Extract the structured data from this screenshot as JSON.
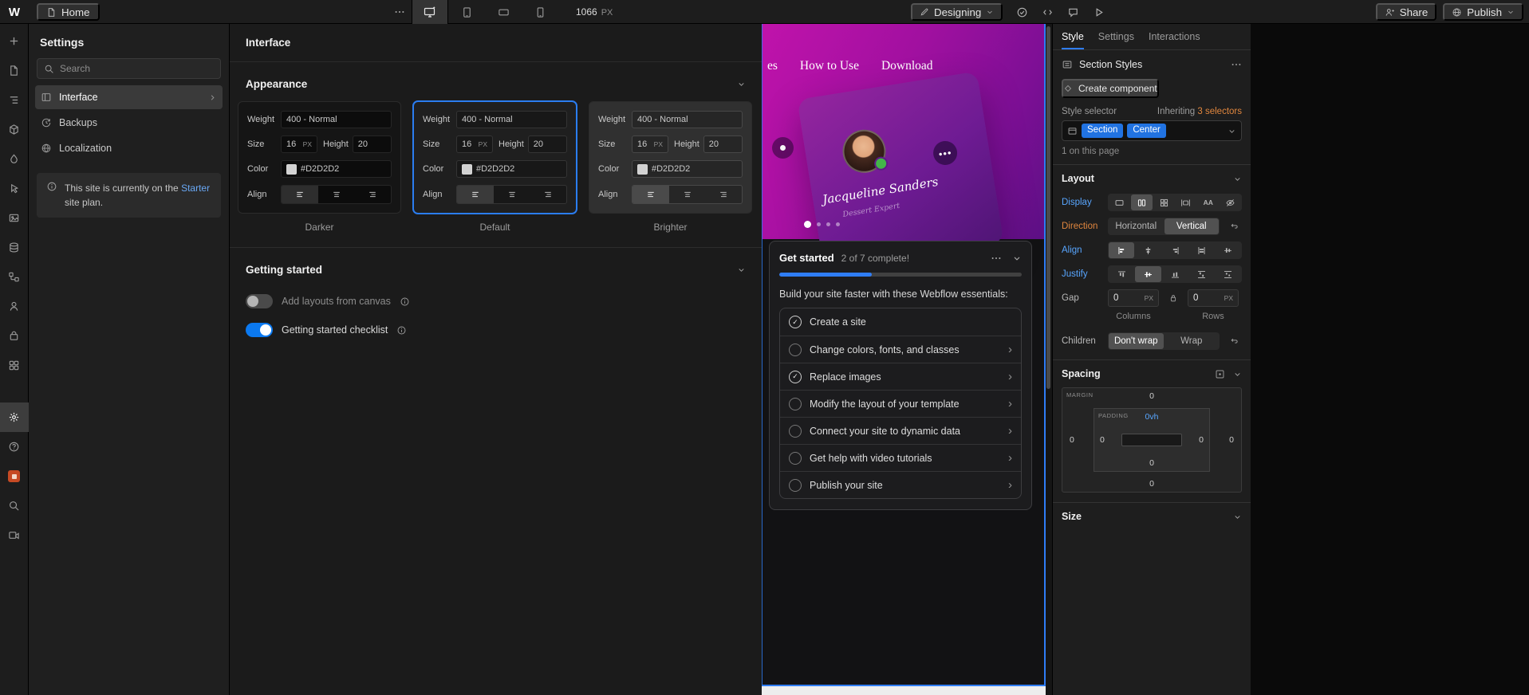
{
  "topbar": {
    "home_label": "Home",
    "canvas_width_value": "1066",
    "canvas_width_unit": "PX",
    "mode_label": "Designing",
    "share_label": "Share",
    "publish_label": "Publish"
  },
  "rail_icons": [
    "add",
    "pages",
    "navigator",
    "components",
    "variables",
    "interactions",
    "assets",
    "cms",
    "logic",
    "users",
    "ecommerce",
    "apps",
    "settings",
    "help",
    "marketplace",
    "search",
    "video-tutorials"
  ],
  "settings_sidebar": {
    "title": "Settings",
    "search_placeholder": "Search",
    "items": [
      {
        "label": "Interface"
      },
      {
        "label": "Backups"
      },
      {
        "label": "Localization"
      }
    ],
    "plan_note": {
      "prefix": "This site is currently on the ",
      "link": "Starter",
      "suffix": " site plan."
    }
  },
  "interface_panel": {
    "title": "Interface",
    "appearance_title": "Appearance",
    "align_selected": 0,
    "themes": [
      {
        "name": "Darker",
        "weight_label": "Weight",
        "weight_value": "400 - Normal",
        "size_label": "Size",
        "size_value": "16",
        "size_unit": "PX",
        "height_label": "Height",
        "height_value": "20",
        "color_label": "Color",
        "color_value": "#D2D2D2",
        "align_label": "Align"
      },
      {
        "name": "Default",
        "weight_label": "Weight",
        "weight_value": "400 - Normal",
        "size_label": "Size",
        "size_value": "16",
        "size_unit": "PX",
        "height_label": "Height",
        "height_value": "20",
        "color_label": "Color",
        "color_value": "#D2D2D2",
        "align_label": "Align"
      },
      {
        "name": "Brighter",
        "weight_label": "Weight",
        "weight_value": "400 - Normal",
        "size_label": "Size",
        "size_value": "16",
        "size_unit": "PX",
        "height_label": "Height",
        "height_value": "20",
        "color_label": "Color",
        "color_value": "#D2D2D2",
        "align_label": "Align"
      }
    ],
    "getting_started": {
      "title": "Getting started",
      "toggles": [
        {
          "label": "Add layouts from canvas",
          "on": false
        },
        {
          "label": "Getting started checklist",
          "on": true
        }
      ]
    }
  },
  "canvas": {
    "nav_links": [
      "es",
      "How to Use",
      "Download"
    ],
    "profile_card": {
      "name": "Jacqueline Sanders",
      "role": "Dessert Expert"
    },
    "get_started": {
      "title": "Get started",
      "progress_text": "2 of 7 complete!",
      "progress_pct": 38,
      "essentials_text": "Build your site faster with these Webflow essentials:",
      "items": [
        {
          "label": "Create a site",
          "done": true,
          "chevron": false
        },
        {
          "label": "Change colors, fonts, and classes",
          "done": false,
          "chevron": true
        },
        {
          "label": "Replace images",
          "done": true,
          "chevron": true
        },
        {
          "label": "Modify the layout of your template",
          "done": false,
          "chevron": true
        },
        {
          "label": "Connect your site to dynamic data",
          "done": false,
          "chevron": true
        },
        {
          "label": "Get help with video tutorials",
          "done": false,
          "chevron": true
        },
        {
          "label": "Publish your site",
          "done": false,
          "chevron": true
        }
      ]
    }
  },
  "style_panel": {
    "tabs": [
      "Style",
      "Settings",
      "Interactions"
    ],
    "active_tab_index": 0,
    "section_styles_label": "Section Styles",
    "create_component_label": "Create component",
    "style_selector_label": "Style selector",
    "inheriting_prefix": "Inheriting ",
    "inheriting_count": "3 selectors",
    "selector_tags": [
      "Section",
      "Center"
    ],
    "on_page_text": "1 on this page",
    "layout": {
      "title": "Layout",
      "display_label": "Display",
      "display_selected": 1,
      "direction_label": "Direction",
      "direction_options": [
        "Horizontal",
        "Vertical"
      ],
      "direction_selected": 1,
      "align_label": "Align",
      "align_selected": 0,
      "justify_label": "Justify",
      "justify_selected": 1,
      "gap_label": "Gap",
      "gap_columns_value": "0",
      "gap_columns_unit": "PX",
      "gap_rows_value": "0",
      "gap_rows_unit": "PX",
      "columns_label": "Columns",
      "rows_label": "Rows",
      "children_label": "Children",
      "children_options": [
        "Don't wrap",
        "Wrap"
      ],
      "children_selected": 0
    },
    "spacing": {
      "title": "Spacing",
      "margin_label": "MARGIN",
      "padding_label": "PADDING",
      "margin": {
        "top": "0",
        "right": "0",
        "bottom": "0",
        "left": "0"
      },
      "padding": {
        "top": "0vh",
        "right": "0",
        "bottom": "0",
        "left": "0"
      }
    },
    "size_title": "Size"
  },
  "colors": {
    "accent_blue": "#2f7df6",
    "selector_tag_blue": "#2173e2",
    "inherited_orange": "#e0863e",
    "hero_magenta": "#a5109d",
    "toggle_on_blue": "#0b79f0",
    "theme_text_color": "#D2D2D2"
  }
}
